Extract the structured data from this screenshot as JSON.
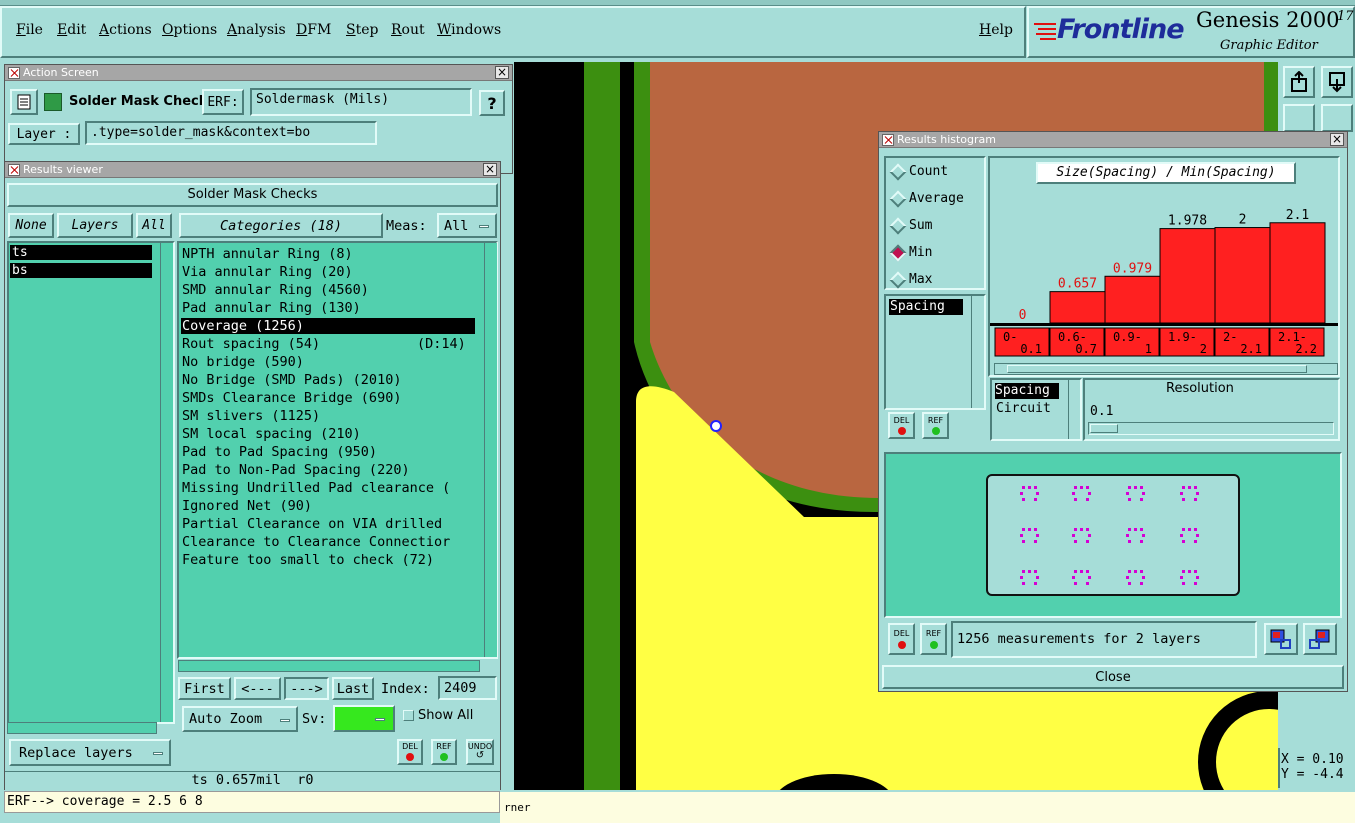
{
  "menu": {
    "items": [
      "File",
      "Edit",
      "Actions",
      "Options",
      "Analysis",
      "DFM",
      "Step",
      "Rout",
      "Windows"
    ],
    "help": "Help"
  },
  "brand": {
    "logo": "Frontline",
    "product": "Genesis 2000",
    "version": "17",
    "subtitle": "Graphic Editor"
  },
  "action_screen": {
    "title": "Action Screen",
    "name": "Solder Mask Checks",
    "erf_label": "ERF:",
    "erf_value": "Soldermask (Mils)",
    "help": "?",
    "layer_label": "Layer :",
    "layer_value": ".type=solder_mask&context=bo"
  },
  "results_viewer": {
    "title": "Results viewer",
    "header": "Solder Mask Checks",
    "none_btn": "None",
    "layers_btn": "Layers",
    "all_btn": "All",
    "layers": [
      "ts",
      "bs"
    ],
    "categories_btn": "Categories (18)",
    "meas_label": "Meas:",
    "meas_value": "All",
    "categories": [
      "NPTH annular Ring (8)",
      "Via annular Ring (20)",
      "SMD annular Ring (4560)",
      "Pad annular Ring (130)",
      "Coverage (1256)",
      "Rout spacing (54)",
      "No bridge (590)",
      "No Bridge (SMD Pads) (2010)",
      "SMDs Clearance Bridge (690)",
      "SM slivers (1125)",
      "SM local spacing (210)",
      "Pad to Pad Spacing (950)",
      "Pad to Non-Pad Spacing (220)",
      "Missing Undrilled Pad clearance (",
      "Ignored Net (90)",
      "Partial Clearance on VIA drilled",
      "Clearance to Clearance Connectior",
      "Feature too small to check (72)"
    ],
    "rout_note": "(D:14)",
    "selected_category": 4,
    "first": "First",
    "prev": "<---",
    "next": "--->",
    "last": "Last",
    "index_label": "Index:",
    "index_value": "2409",
    "auto_zoom": "Auto Zoom",
    "sv_label": "Sv:",
    "show_all": "Show All",
    "replace_layers": "Replace layers",
    "del": "DEL",
    "ref": "REF",
    "undo": "UNDO",
    "status": "ts 0.657mil  r0"
  },
  "erf_line": "ERF--> coverage = 2.5 6 8",
  "bottom_hint": "rner",
  "histogram": {
    "title": "Results histogram",
    "modes": [
      "Count",
      "Average",
      "Sum",
      "Min",
      "Max"
    ],
    "selected_mode": "Min",
    "measure_list": [
      "Spacing"
    ],
    "chart_title": "Size(Spacing) / Min(Spacing)",
    "resolution_label": "Resolution",
    "resolution_value": "0.1",
    "res_list": [
      "Spacing",
      "Circuit"
    ],
    "summary": "1256 measurements for 2 layers",
    "close": "Close",
    "del": "DEL",
    "ref": "REF"
  },
  "chart_data": {
    "type": "bar",
    "title": "Size(Spacing) / Min(Spacing)",
    "categories": [
      "0-0.1",
      "0.6-0.7",
      "0.9-1",
      "1.9-2",
      "2-2.1",
      "2.1-2.2"
    ],
    "values": [
      0,
      0.657,
      0.979,
      1.978,
      2,
      2.1
    ],
    "value_labels": [
      "0",
      "0.657",
      "0.979",
      "1.978",
      "2",
      "2.1"
    ],
    "bin_labels": [
      [
        "0-",
        "0.1"
      ],
      [
        "0.6-",
        "0.7"
      ],
      [
        "0.9-",
        "1"
      ],
      [
        "1.9-",
        "2"
      ],
      [
        "2-",
        "2.1"
      ],
      [
        "2.1-",
        "2.2"
      ]
    ],
    "ylim": [
      0,
      2.2
    ],
    "bar_color": "#ff2020",
    "grid": false
  },
  "coords": {
    "x": "X = 0.10",
    "y": "Y = -4.4"
  },
  "colors": {
    "bg": "#a6ddd8",
    "list_green": "#52d0ae",
    "copper": "#b96640",
    "mask_green": "#3c8f10",
    "yellow": "#ffff44"
  }
}
